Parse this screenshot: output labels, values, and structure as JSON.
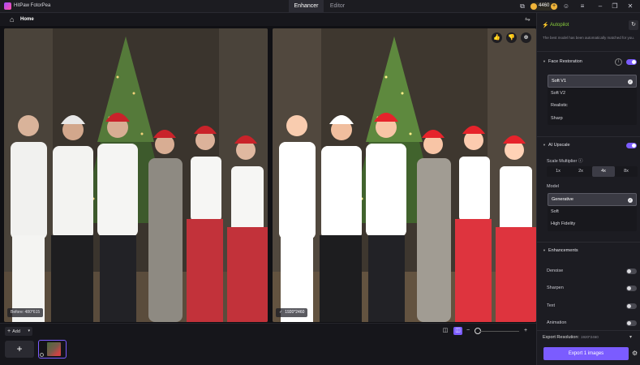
{
  "app": {
    "title": "HitPaw FotorPea"
  },
  "tabs": [
    {
      "label": "Enhancer",
      "active": true
    },
    {
      "label": "Editor",
      "active": false
    }
  ],
  "topbar": {
    "coins": "4460",
    "coin_plus": "+",
    "icons": [
      "share-icon",
      "coin-icon",
      "user-icon",
      "menu-icon",
      "minimize-icon",
      "restore-icon",
      "close-icon"
    ]
  },
  "homebar": {
    "home_label": "Home"
  },
  "preview": {
    "before_label": "Before: 480*615",
    "after_label": "1920*2460"
  },
  "bottom": {
    "add_label": "Add",
    "add_plus": "+",
    "big_plus": "+"
  },
  "panel": {
    "autopilot_title": "Autopilot",
    "autopilot_desc": "The best model has been automatically matched for you.",
    "face_restoration": {
      "title": "Face Restoration",
      "enabled": true,
      "options": [
        "Soft V1",
        "Soft V2",
        "Realistic",
        "Sharp"
      ],
      "selected": "Soft V1"
    },
    "ai_upscale": {
      "title": "AI Upscale",
      "enabled": true,
      "scale_label": "Scale Multiplier",
      "scales": [
        "1x",
        "2x",
        "4x",
        "8x"
      ],
      "selected_scale": "4x",
      "model_label": "Model",
      "models": [
        "Generative",
        "Soft",
        "High Fidelity"
      ],
      "selected_model": "Generative"
    },
    "enhancements": {
      "title": "Enhancements",
      "items": [
        {
          "label": "Denoise",
          "enabled": false
        },
        {
          "label": "Sharpen",
          "enabled": false
        },
        {
          "label": "Text",
          "enabled": false
        },
        {
          "label": "Animation",
          "enabled": false
        }
      ]
    },
    "export_resolution_label": "Export Resolution:",
    "export_resolution_value": "1920*2460",
    "export_button": "Export 1 images"
  },
  "colors": {
    "accent": "#7b5cff",
    "autopilot": "#8bd13e",
    "coin": "#f0b43a"
  }
}
